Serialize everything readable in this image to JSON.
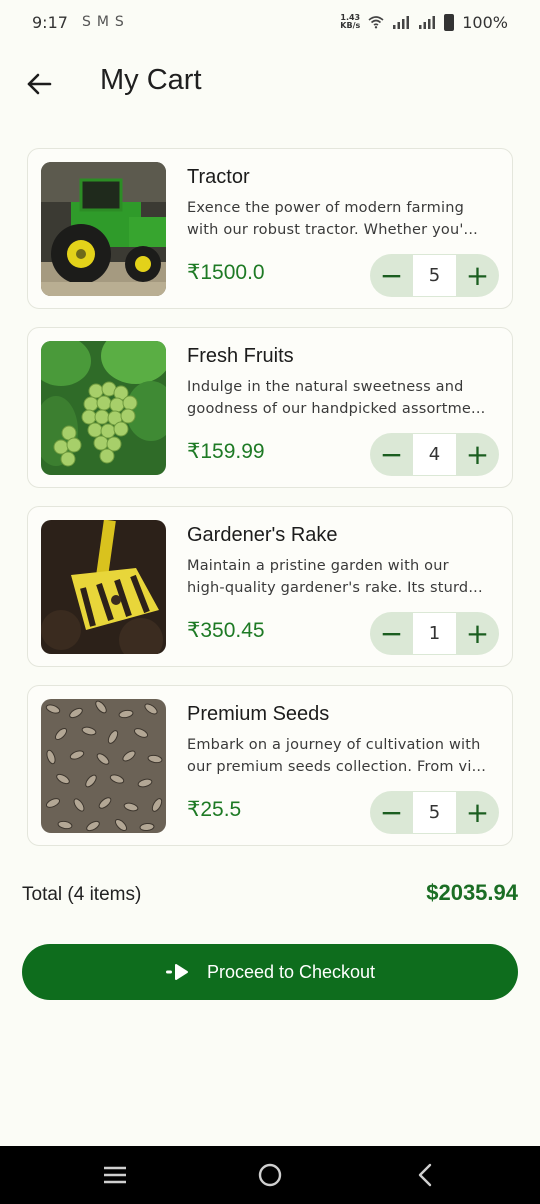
{
  "status_bar": {
    "time": "9:17",
    "notif_icons": [
      "S",
      "M",
      "S"
    ],
    "net_speed_value": "1.43",
    "net_speed_unit": "KB/s",
    "battery": "100%"
  },
  "header": {
    "title": "My Cart",
    "back_icon": "arrow-left-icon"
  },
  "cart": {
    "items": [
      {
        "name": "Tractor",
        "desc_line1": "Exence the power of modern farming",
        "desc_line2": "with our robust tractor. Whether you'...",
        "price": "₹1500.0",
        "quantity": "5",
        "minus": "−",
        "plus": "+"
      },
      {
        "name": "Fresh Fruits",
        "desc_line1": "Indulge in the natural sweetness and",
        "desc_line2": "goodness of our handpicked assortme...",
        "price": "₹159.99",
        "quantity": "4",
        "minus": "−",
        "plus": "+"
      },
      {
        "name": "Gardener's Rake",
        "desc_line1": "Maintain a pristine garden with our",
        "desc_line2": "high-quality gardener's rake. Its sturd...",
        "price": "₹350.45",
        "quantity": "1",
        "minus": "−",
        "plus": "+"
      },
      {
        "name": "Premium Seeds",
        "desc_line1": "Embark on a journey of cultivation with",
        "desc_line2": "our premium seeds collection. From vi...",
        "price": "₹25.5",
        "quantity": "5",
        "minus": "−",
        "plus": "+"
      }
    ]
  },
  "summary": {
    "total_label": "Total (4 items)",
    "total_value": "$2035.94"
  },
  "checkout": {
    "label": "Proceed to Checkout",
    "icon": "checkout-arrow-icon"
  },
  "colors": {
    "accent": "#0e6d1d",
    "price": "#1e7a25",
    "stepper_bg": "#dbe8d6",
    "background": "#fbfcf6"
  },
  "nav_bar": {
    "icons": [
      "recents-icon",
      "home-icon",
      "back-icon"
    ]
  }
}
